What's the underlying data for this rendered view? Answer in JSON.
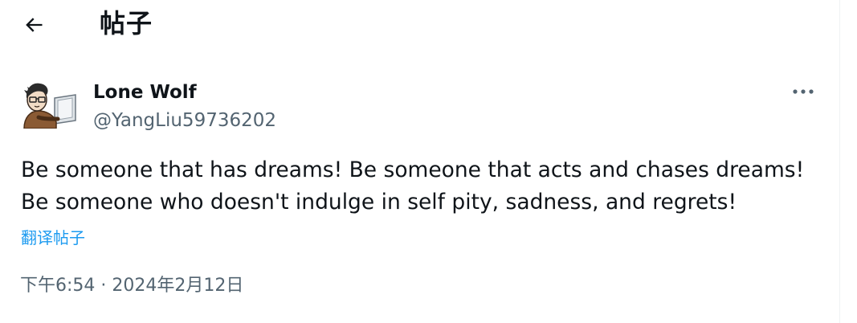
{
  "header": {
    "title": "帖子",
    "back_icon": "arrow-left-icon"
  },
  "post": {
    "author": {
      "display_name": "Lone Wolf",
      "handle": "@YangLiu59736202",
      "avatar_icon": "avatar-cartoon-man-at-laptop"
    },
    "more_icon": "ellipsis-icon",
    "text": "Be someone that has dreams! Be someone that acts and chases dreams! Be someone who doesn't indulge in self pity, sadness, and regrets!",
    "translate_label": "翻译帖子",
    "timestamp": "下午6:54 · 2024年2月12日"
  },
  "colors": {
    "text_primary": "#0f1419",
    "text_secondary": "#536471",
    "link": "#1d9bf0",
    "border": "#eff3f4"
  }
}
